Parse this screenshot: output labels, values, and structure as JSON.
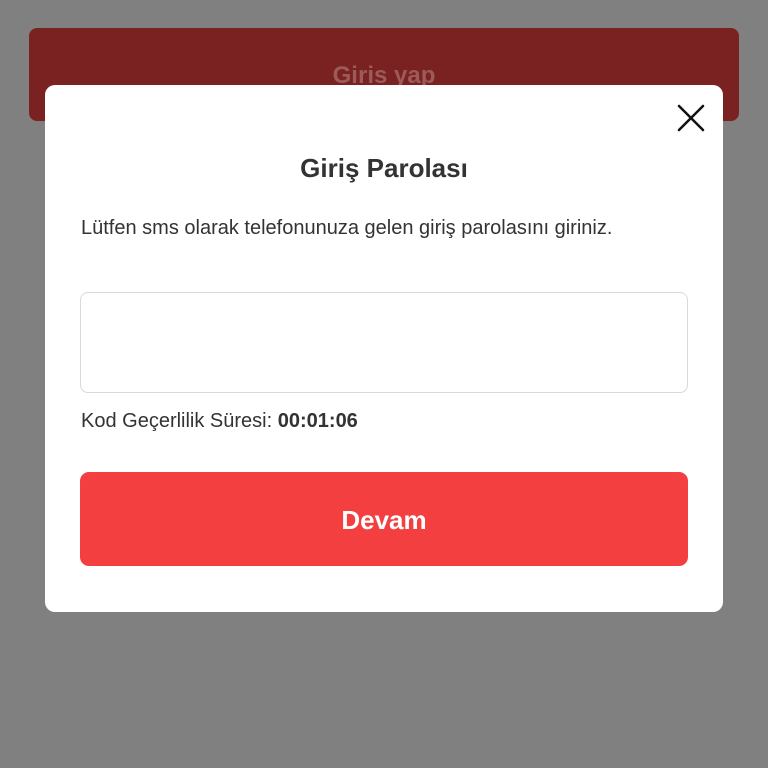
{
  "background": {
    "login_button_label": "Giris yap"
  },
  "modal": {
    "title": "Giriş Parolası",
    "description": "Lütfen sms olarak telefonunuza gelen giriş parolasını giriniz.",
    "code_input": {
      "value": "",
      "placeholder": ""
    },
    "validity_label": "Kod Geçerlilik Süresi:",
    "validity_timer": "00:01:06",
    "continue_label": "Devam",
    "close_icon": "close-icon"
  },
  "colors": {
    "overlay": "#808080",
    "background_button": "#7a2222",
    "primary": "#f43f41",
    "modal_bg": "#ffffff",
    "text": "#333333"
  }
}
